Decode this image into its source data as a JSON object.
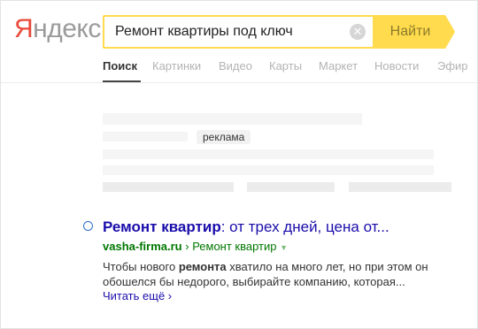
{
  "logo": {
    "first_letter": "Я",
    "rest": "ндекс"
  },
  "search": {
    "query": "Ремонт квартиры под ключ",
    "clear_glyph": "✕",
    "button_label": "Найти"
  },
  "tabs": [
    {
      "label": "Поиск",
      "active": true
    },
    {
      "label": "Картинки"
    },
    {
      "label": "Видео"
    },
    {
      "label": "Карты"
    },
    {
      "label": "Маркет"
    },
    {
      "label": "Новости"
    },
    {
      "label": "Эфир"
    }
  ],
  "ad_badge": "реклама",
  "result": {
    "title_bold": "Ремонт квартир",
    "title_rest": ": от трех дней, цена от...",
    "domain": "vasha-firma.ru",
    "separator": "›",
    "breadcrumb": "Ремонт квартир",
    "arrow": "▼",
    "snippet_part1": "Чтобы нового ",
    "snippet_bold": "ремонта",
    "snippet_part2": " хватило на много лет, но при этом он обошелся бы недорого, выбирайте компанию, которая...",
    "read_more": "Читать ещё ›"
  },
  "colors": {
    "logo_red": "#e94a3a",
    "accent_yellow": "#ffdb4d",
    "link_blue": "#1a0dab",
    "url_green": "#007700"
  },
  "icons": [
    "clear-icon",
    "result-radio-icon"
  ]
}
